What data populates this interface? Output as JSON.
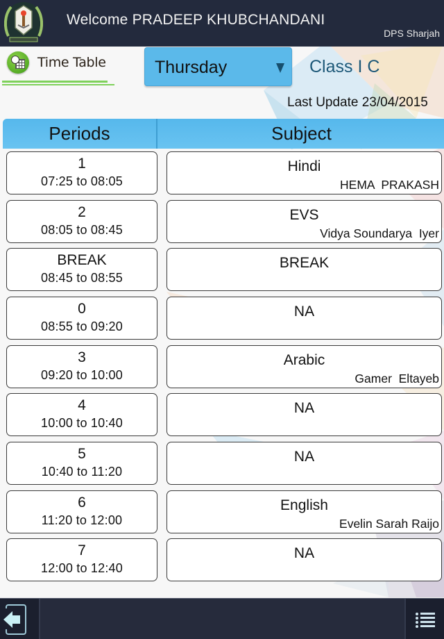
{
  "header": {
    "welcome_text": "Welcome PRADEEP KHUBCHANDANI",
    "school_name": "DPS Sharjah",
    "logo_icon": "school-crest-icon"
  },
  "toolbar": {
    "section_title": "Time Table",
    "section_icon": "timetable-clock-icon",
    "day_select": {
      "selected": "Thursday",
      "icon": "dropdown-caret-icon"
    },
    "class_label": "Class I C",
    "last_update": "Last Update 23/04/2015"
  },
  "table": {
    "headers": {
      "periods": "Periods",
      "subject": "Subject"
    },
    "rows": [
      {
        "period": "1",
        "time": "07:25 to 08:05",
        "subject": "Hindi",
        "teacher": "HEMA  PRAKASH"
      },
      {
        "period": "2",
        "time": "08:05 to 08:45",
        "subject": "EVS",
        "teacher": "Vidya Soundarya  Iyer"
      },
      {
        "period": "BREAK",
        "time": "08:45 to 08:55",
        "subject": "BREAK",
        "teacher": ""
      },
      {
        "period": "0",
        "time": "08:55 to 09:20",
        "subject": "NA",
        "teacher": ""
      },
      {
        "period": "3",
        "time": "09:20 to 10:00",
        "subject": "Arabic",
        "teacher": "Gamer  Eltayeb"
      },
      {
        "period": "4",
        "time": "10:00 to 10:40",
        "subject": "NA",
        "teacher": ""
      },
      {
        "period": "5",
        "time": "10:40 to 11:20",
        "subject": "NA",
        "teacher": ""
      },
      {
        "period": "6",
        "time": "11:20 to 12:00",
        "subject": "English",
        "teacher": "Evelin Sarah Raijo"
      },
      {
        "period": "7",
        "time": "12:00 to 12:40",
        "subject": "NA",
        "teacher": ""
      }
    ]
  },
  "footer": {
    "back_icon": "logout-arrow-icon",
    "menu_icon": "list-menu-icon"
  },
  "colors": {
    "header_bg": "#232a3d",
    "accent_blue": "#5bb9ea",
    "class_text": "#1d5878",
    "title_underline": "#7ed15a"
  }
}
